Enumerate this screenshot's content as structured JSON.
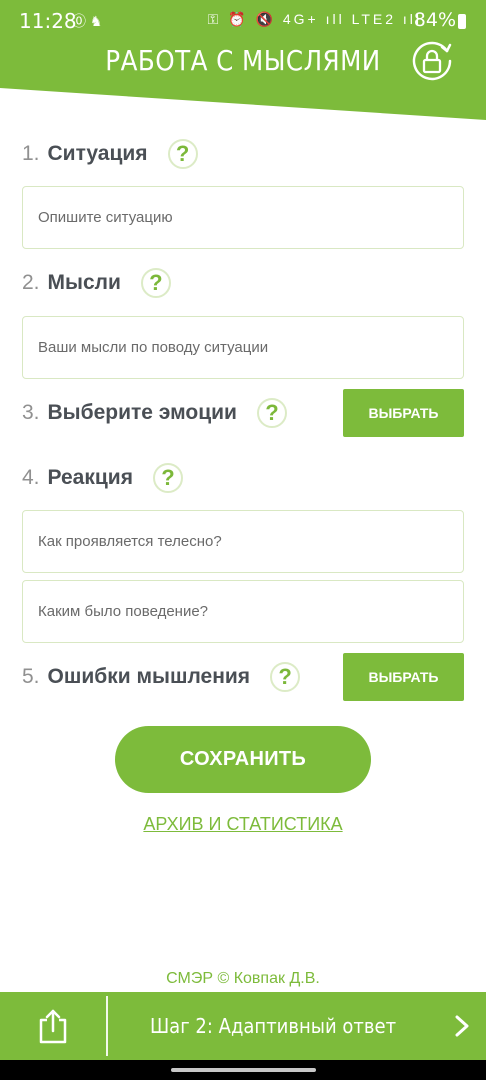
{
  "status_bar": {
    "time": "11:28",
    "left_icons": "⓪ ♞",
    "right_icons": "⚿ ⏰ 🔇 4G+ ıll LTE2 ıll",
    "battery": "84%"
  },
  "header": {
    "title": "РАБОТА С МЫСЛЯМИ",
    "accent_color": "#7dbb3b"
  },
  "form": {
    "situation": {
      "number": "1.",
      "label": "Ситуация",
      "placeholder": "Опишите ситуацию"
    },
    "thoughts": {
      "number": "2.",
      "label": "Мысли",
      "placeholder": "Ваши мысли по поводу ситуации"
    },
    "emotions": {
      "number": "3.",
      "label": "Выберите эмоции",
      "button": "ВЫБРАТЬ"
    },
    "reaction": {
      "number": "4.",
      "label": "Реакция",
      "placeholder_body": "Как проявляется телесно?",
      "placeholder_behavior": "Каким было поведение?"
    },
    "errors": {
      "number": "5.",
      "label": "Ошибки мышления",
      "button": "ВЫБРАТЬ"
    },
    "help_glyph": "?"
  },
  "actions": {
    "save": "СОХРАНИТЬ",
    "archive": "АРХИВ И СТАТИСТИКА"
  },
  "footer": {
    "copyright": "СМЭР © Ковпак Д.В.",
    "step": "Шаг 2: Адаптивный ответ"
  }
}
